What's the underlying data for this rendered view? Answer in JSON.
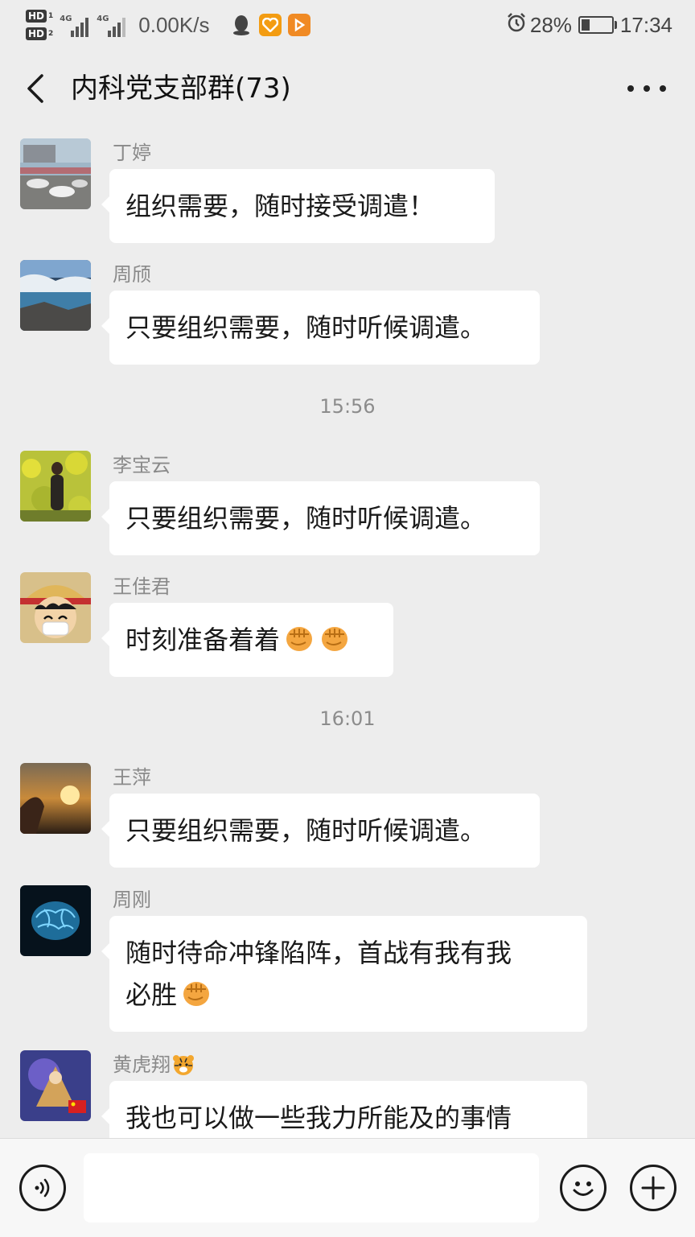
{
  "status_bar": {
    "hd1": "HD",
    "hd1_sub": "1",
    "hd2": "HD",
    "hd2_sub": "2",
    "sig1_label": "4G",
    "sig2_label": "4G",
    "net_speed": "0.00K/s",
    "battery_percent": "28%",
    "battery_level": 0.28,
    "time": "17:34"
  },
  "header": {
    "title": "内科党支部群(73)"
  },
  "messages": [
    {
      "sender": "丁婷",
      "text": "组织需要，随时接受调遣！"
    },
    {
      "sender": "周颀",
      "text": "只要组织需要，随时听候调遣。"
    },
    {
      "sender": "李宝云",
      "text": "只要组织需要，随时听候调遣。"
    },
    {
      "sender": "王佳君",
      "text": "时刻准备着着"
    },
    {
      "sender": "王萍",
      "text": "只要组织需要，随时听候调遣。"
    },
    {
      "sender": "周刚",
      "line1": "随时待命冲锋陷阵，首战有我有我",
      "line2": "必胜"
    },
    {
      "sender": "黄虎翔",
      "text": "我也可以做一些我力所能及的事情"
    }
  ],
  "timestamps": [
    "15:56",
    "16:01"
  ],
  "icons": {
    "back": "back-arrow-icon",
    "more": "more-icon",
    "voice": "voice-icon",
    "emoji": "emoji-icon",
    "plus": "plus-icon",
    "fist": "fist-emoji-icon",
    "tiger": "tiger-emoji-icon"
  },
  "colors": {
    "background": "#ededed",
    "bubble": "#ffffff",
    "sender": "#8a8a8a",
    "timestamp": "#8c8c8c"
  }
}
